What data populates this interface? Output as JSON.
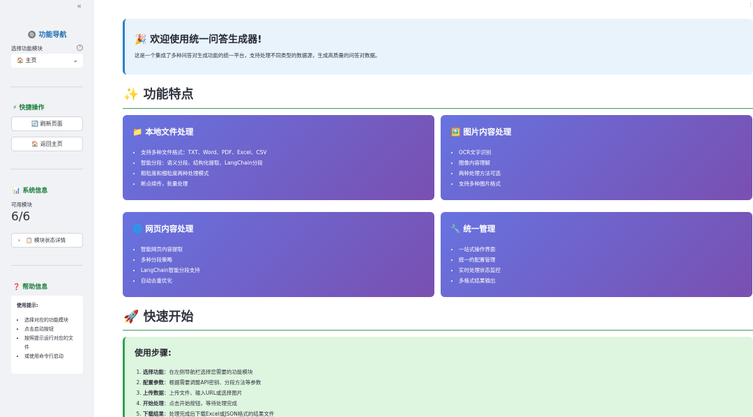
{
  "sidebar": {
    "collapse_icon": "«",
    "title": "🔘 功能导航",
    "select_label": "选择功能模块",
    "help_icon": "?",
    "select_value": "🏠 主页",
    "quick_actions_title": "⚡ 快捷操作",
    "refresh_label": "🔄 刷新页面",
    "home_label": "🏠 返回主页",
    "system_info_title": "📊 系统信息",
    "metric_label": "可用模块",
    "metric_value": "6/6",
    "module_status_label": "📋 模块状态详情",
    "help_title": "❓ 帮助信息",
    "tips_title": "使用提示:",
    "tips": [
      "选择对应的功能模块",
      "点击启动按钮",
      "按照提示运行对应的文件",
      "或使用命令行启动"
    ]
  },
  "main": {
    "corner_icon": "⋮",
    "welcome_title": "🎉 欢迎使用统一问答生成器!",
    "welcome_text": "这是一个集成了多种问答对生成功能的统一平台，支持处理不同类型的数据源，生成高质量的问答对数据。",
    "features_heading": "✨ 功能特点",
    "cards": [
      {
        "title": "📁 本地文件处理",
        "items": [
          "支持多种文件格式：TXT、Word、PDF、Excel、CSV",
          "智能分段：语义分段、结构化提取、LangChain分段",
          "粗粒度和细粒度两种处理模式",
          "断点续传，批量处理"
        ]
      },
      {
        "title": "🖼️ 图片内容处理",
        "items": [
          "OCR文字识别",
          "图像内容理解",
          "两种处理方法可选",
          "支持多种图片格式"
        ]
      },
      {
        "title": "🌐 网页内容处理",
        "items": [
          "智能网页内容提取",
          "多种分段策略",
          "LangChain智能分段支持",
          "自动去重优化"
        ]
      },
      {
        "title": "🔧 统一管理",
        "items": [
          "一站式操作界面",
          "统一的配置管理",
          "实时处理状态监控",
          "多格式结果输出"
        ]
      }
    ],
    "quickstart_heading": "🚀 快速开始",
    "steps_title": "使用步骤:",
    "steps": [
      {
        "bold": "选择功能",
        "text": "：在左侧导航栏选择您需要的功能模块"
      },
      {
        "bold": "配置参数",
        "text": "：根据需要调整API密钥、分段方法等参数"
      },
      {
        "bold": "上传数据",
        "text": "：上传文件、输入URL或选择图片"
      },
      {
        "bold": "开始处理",
        "text": "：点击开始按钮，等待处理完成"
      },
      {
        "bold": "下载结果",
        "text": "：处理完成后下载Excel或JSON格式的结果文件"
      }
    ]
  }
}
